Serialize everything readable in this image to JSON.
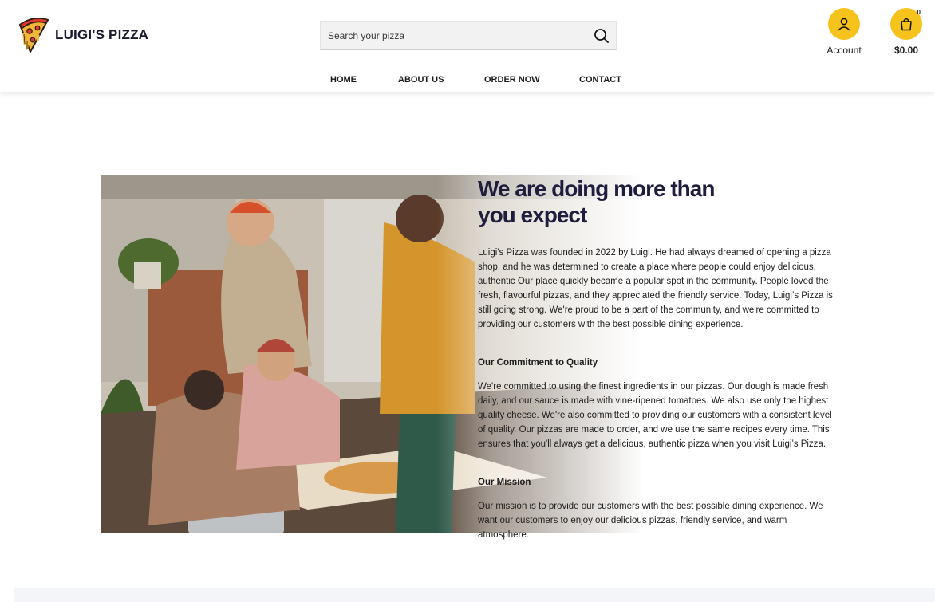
{
  "brand": {
    "name": "LUIGI'S PIZZA",
    "logo_icon": "pizza-slice-icon"
  },
  "search": {
    "placeholder": "Search your pizza",
    "button_icon": "search-icon"
  },
  "account": {
    "label": "Account",
    "icon": "user-icon"
  },
  "cart": {
    "count": "0",
    "total": "$0.00",
    "icon": "shopping-bag-icon"
  },
  "nav": {
    "items": [
      {
        "label": "HOME"
      },
      {
        "label": "ABOUT US"
      },
      {
        "label": "ORDER NOW"
      },
      {
        "label": "CONTACT"
      }
    ]
  },
  "about": {
    "heading_line1": "We are doing more than",
    "heading_line2": "you expect",
    "intro": "Luigi's Pizza was founded in 2022 by Luigi. He had always dreamed of opening a pizza shop, and he was determined to create a place where people could enjoy delicious, authentic Our place quickly became a popular spot in the community. People loved the fresh, flavourful pizzas, and they appreciated the friendly service. Today, Luigi’s Pizza is still going strong. We're proud to be a part of the community, and we're committed to providing our customers with the best possible dining experience.",
    "quality_title": "Our Commitment to Quality",
    "quality_text": "We're committed to using the finest ingredients in our pizzas. Our dough is made fresh daily, and our sauce is made with vine-ripened tomatoes. We also use only the highest quality cheese. We're also committed to providing our customers with a consistent level of quality. Our pizzas are made to order, and we use the same recipes every time. This ensures that you'll always get a delicious, authentic pizza when you visit Luigi’s Pizza.",
    "mission_title": "Our Mission",
    "mission_text": "Our mission is to provide our customers with the best possible dining experience. We want our customers to enjoy our delicious pizzas, friendly service, and warm atmosphere."
  },
  "colors": {
    "accent": "#f6c21c",
    "heading": "#1f1d3d",
    "logo_red": "#e0382b"
  }
}
